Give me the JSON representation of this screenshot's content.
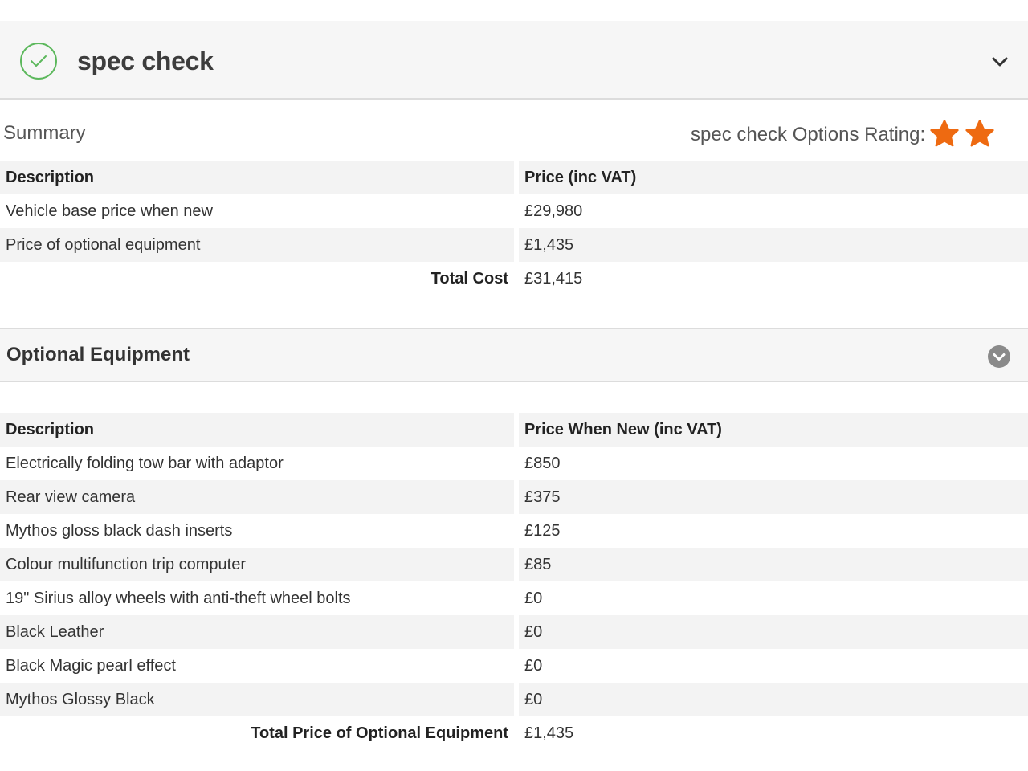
{
  "header": {
    "title": "spec check",
    "colors": {
      "check": "#5cb85c",
      "star": "#ee6a11"
    }
  },
  "summary": {
    "label": "Summary",
    "rating_label": "spec check Options Rating:",
    "rating_stars": 2,
    "columns": [
      "Description",
      "Price (inc VAT)"
    ],
    "rows": [
      [
        "Vehicle base price when new",
        "£29,980"
      ],
      [
        "Price of optional equipment",
        "£1,435"
      ]
    ],
    "total_label": "Total Cost",
    "total_value": "£31,415"
  },
  "optional": {
    "title": "Optional Equipment",
    "columns": [
      "Description",
      "Price When New (inc VAT)"
    ],
    "rows": [
      [
        "Electrically folding tow bar with adaptor",
        "£850"
      ],
      [
        "Rear view camera",
        "£375"
      ],
      [
        "Mythos gloss black dash inserts",
        "£125"
      ],
      [
        "Colour multifunction trip computer",
        "£85"
      ],
      [
        "19\" Sirius alloy wheels with anti-theft wheel bolts",
        "£0"
      ],
      [
        "Black Leather",
        "£0"
      ],
      [
        "Black Magic pearl effect",
        "£0"
      ],
      [
        "Mythos Glossy Black",
        "£0"
      ]
    ],
    "total_label": "Total Price of Optional Equipment",
    "total_value": "£1,435"
  }
}
